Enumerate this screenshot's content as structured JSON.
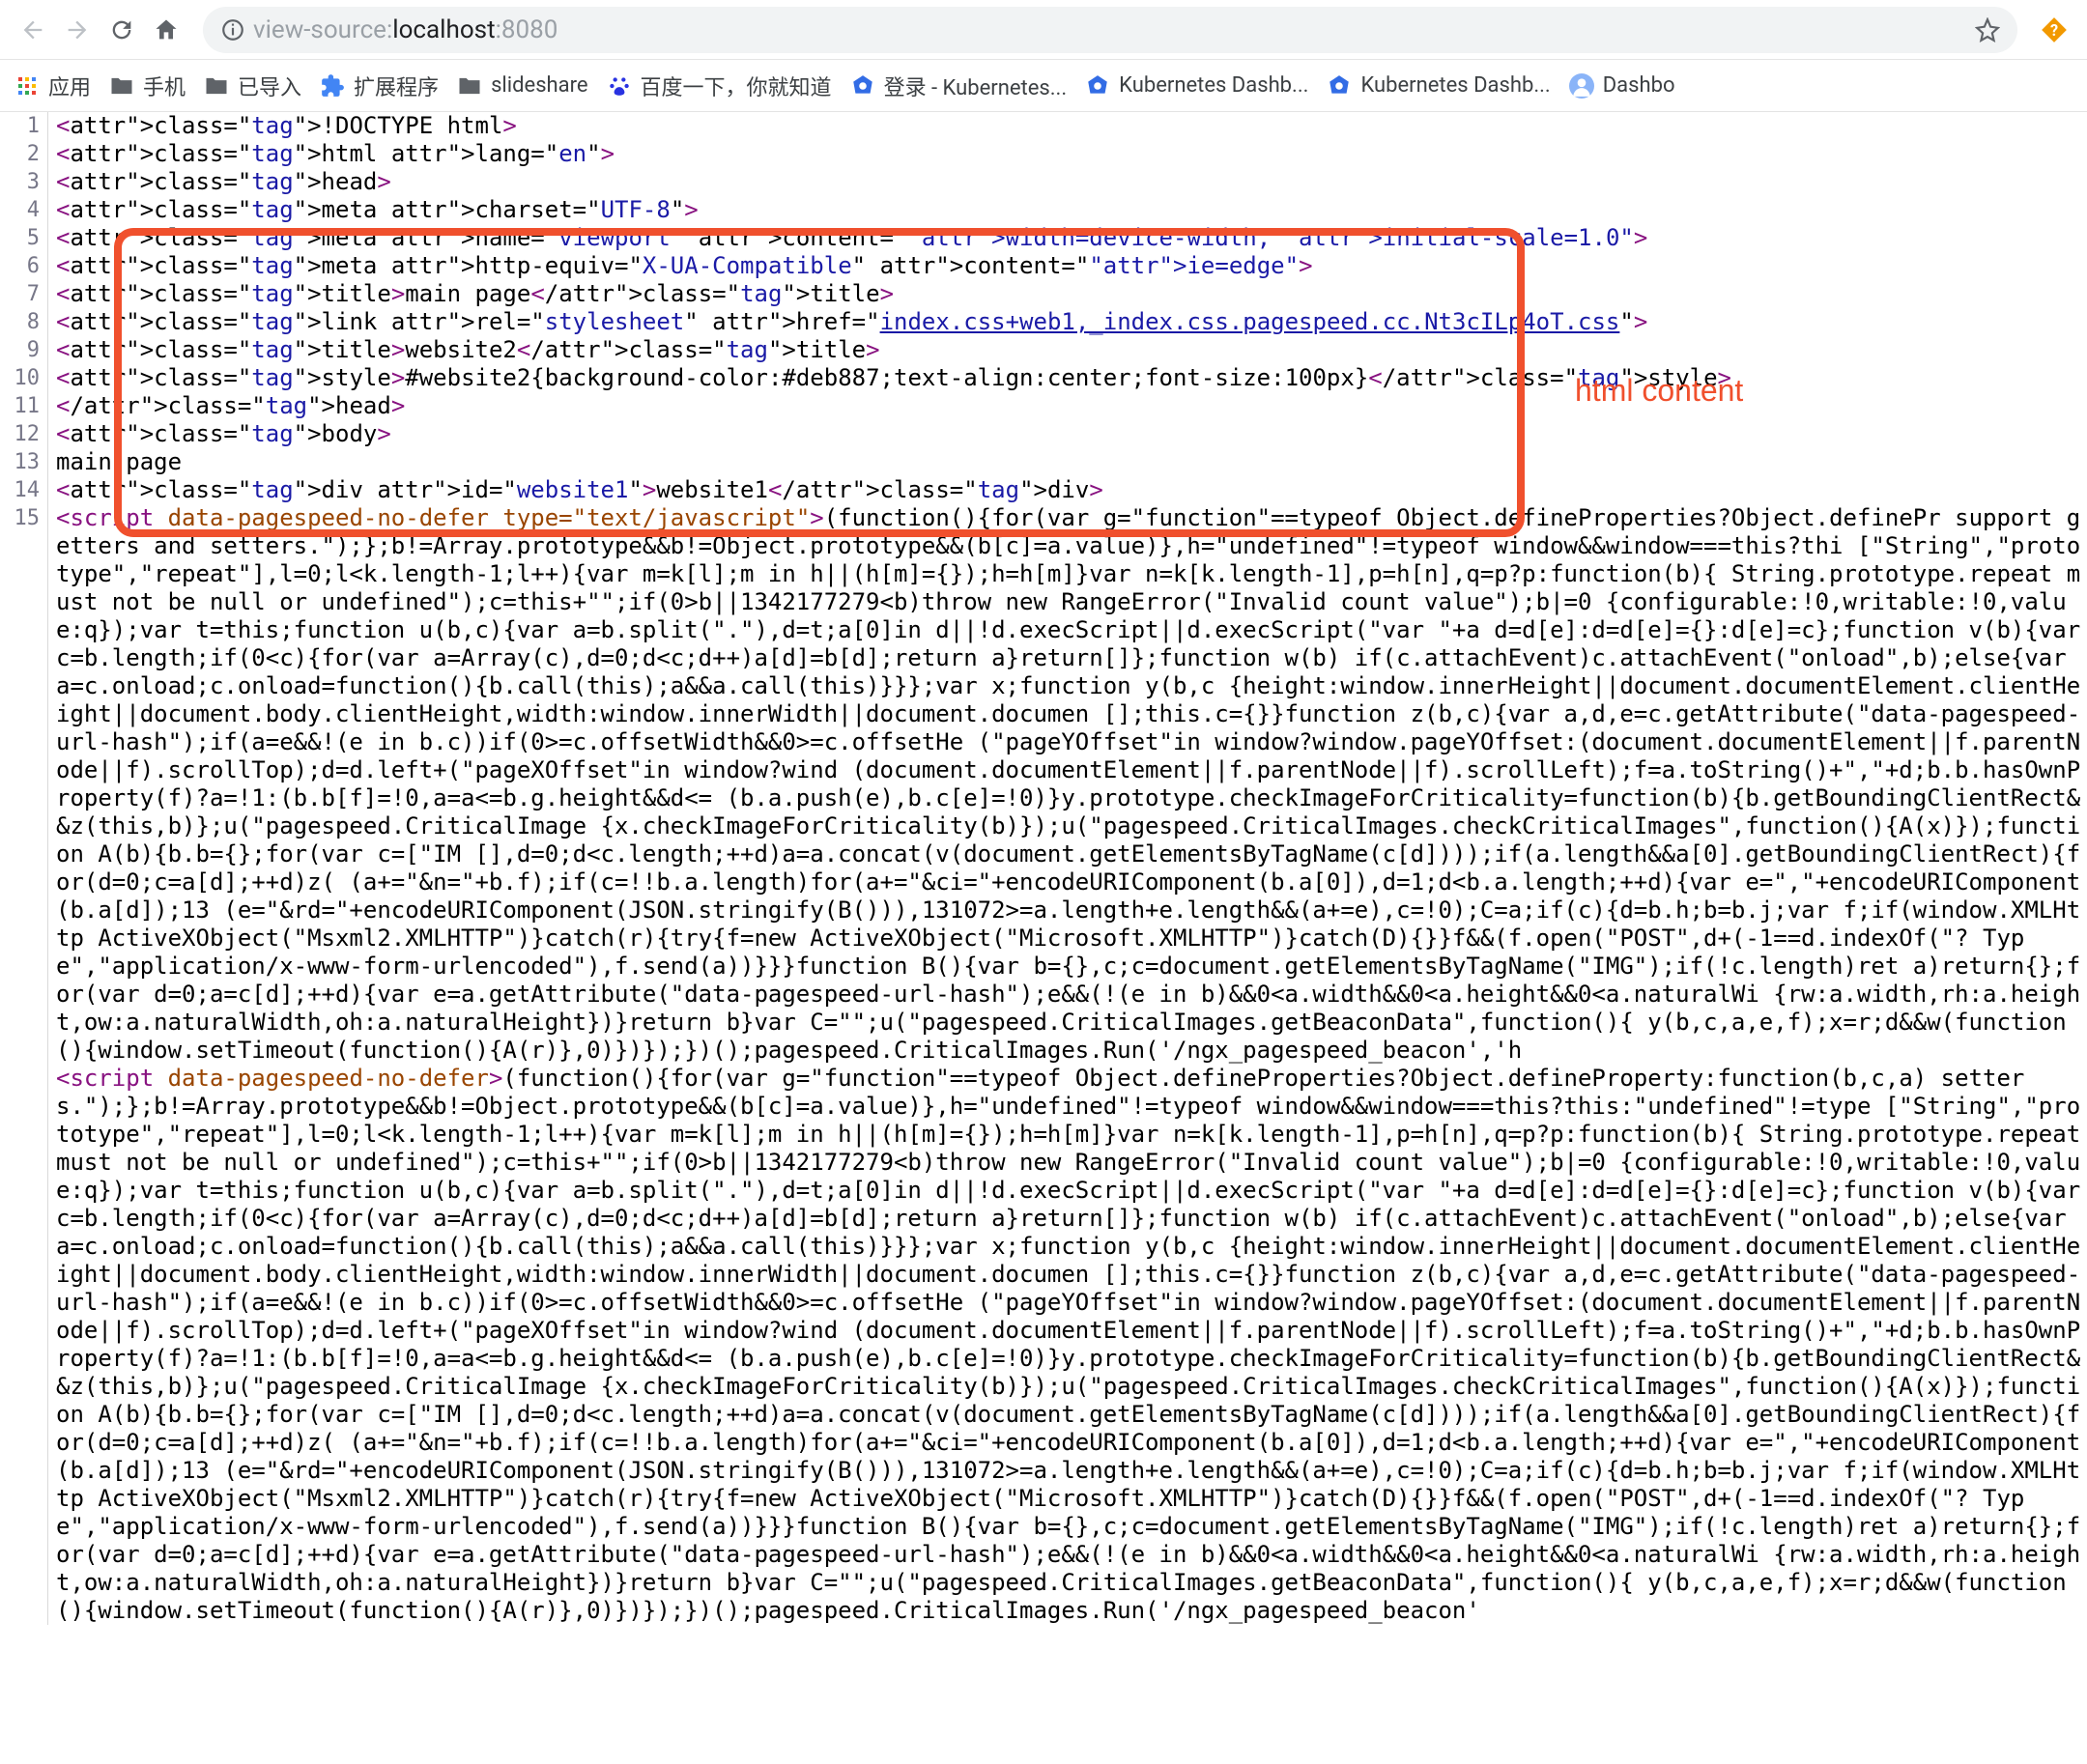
{
  "toolbar": {
    "url_prefix": "view-source:",
    "url_host": "localhost",
    "url_port": ":8080"
  },
  "bookmarks": [
    {
      "type": "apps",
      "label": "应用"
    },
    {
      "type": "folder",
      "label": "手机"
    },
    {
      "type": "folder",
      "label": "已导入"
    },
    {
      "type": "ext",
      "label": "扩展程序"
    },
    {
      "type": "folder",
      "label": "slideshare"
    },
    {
      "type": "baidu",
      "label": "百度一下，你就知道"
    },
    {
      "type": "k8s",
      "label": "登录 - Kubernetes..."
    },
    {
      "type": "k8s",
      "label": "Kubernetes Dashb..."
    },
    {
      "type": "k8s",
      "label": "Kubernetes Dashb..."
    },
    {
      "type": "avatar",
      "label": "Dashbo"
    }
  ],
  "annotation": "html content",
  "source": {
    "lines": [
      "<!DOCTYPE html>",
      "<html lang=\"en\">",
      "<head>",
      "<meta charset=\"UTF-8\">",
      "<meta name=\"viewport\" content=\"width=device-width, initial-scale=1.0\">",
      "<meta http-equiv=\"X-UA-Compatible\" content=\"ie=edge\">",
      "<title>main page</title>",
      "<link rel=\"stylesheet\" href=\"index.css+web1,_index.css.pagespeed.cc.Nt3cILp4oT.css\">",
      "<title>website2</title>",
      "<style>#website2{background-color:#deb887;text-align:center;font-size:100px}</style>",
      "</head>",
      "<body>",
      "main page",
      "<div id=\"website1\">website1</div>"
    ],
    "script1": "<script data-pagespeed-no-defer type=\"text/javascript\">(function(){for(var g=\"function\"==typeof Object.defineProperties?Object.definePr support getters and setters.\");};b!=Array.prototype&&b!=Object.prototype&&(b[c]=a.value)},h=\"undefined\"!=typeof window&&window===this?thi [\"String\",\"prototype\",\"repeat\"],l=0;l<k.length-1;l++){var m=k[l];m in h||(h[m]={});h=h[m]}var n=k[k.length-1],p=h[n],q=p?p:function(b){ String.prototype.repeat must not be null or undefined\");c=this+\"\";if(0>b||1342177279<b)throw new RangeError(\"Invalid count value\");b|=0 {configurable:!0,writable:!0,value:q});var t=this;function u(b,c){var a=b.split(\".\"),d=t;a[0]in d||!d.execScript||d.execScript(\"var \"+a d=d[e]:d=d[e]={}:d[e]=c};function v(b){var c=b.length;if(0<c){for(var a=Array(c),d=0;d<c;d++)a[d]=b[d];return a}return[]};function w(b) if(c.attachEvent)c.attachEvent(\"onload\",b);else{var a=c.onload;c.onload=function(){b.call(this);a&&a.call(this)}}};var x;function y(b,c {height:window.innerHeight||document.documentElement.clientHeight||document.body.clientHeight,width:window.innerWidth||document.documen [];this.c={}}function z(b,c){var a,d,e=c.getAttribute(\"data-pagespeed-url-hash\");if(a=e&&!(e in b.c))if(0>=c.offsetWidth&&0>=c.offsetHe (\"pageYOffset\"in window?window.pageYOffset:(document.documentElement||f.parentNode||f).scrollTop);d=d.left+(\"pageXOffset\"in window?wind (document.documentElement||f.parentNode||f).scrollLeft);f=a.toString()+\",\"+d;b.b.hasOwnProperty(f)?a=!1:(b.b[f]=!0,a=a<=b.g.height&&d<= (b.a.push(e),b.c[e]=!0)}y.prototype.checkImageForCriticality=function(b){b.getBoundingClientRect&&z(this,b)};u(\"pagespeed.CriticalImage {x.checkImageForCriticality(b)});u(\"pagespeed.CriticalImages.checkCriticalImages\",function(){A(x)});function A(b){b.b={};for(var c=[\"IM [],d=0;d<c.length;++d)a=a.concat(v(document.getElementsByTagName(c[d])));if(a.length&&a[0].getBoundingClientRect){for(d=0;c=a[d];++d)z( (a+=\"&n=\"+b.f);if(c=!!b.a.length)for(a+=\"&ci=\"+encodeURIComponent(b.a[0]),d=1;d<b.a.length;++d){var e=\",\"+encodeURIComponent(b.a[d]);13 (e=\"&rd=\"+encodeURIComponent(JSON.stringify(B())),131072>=a.length+e.length&&(a+=e),c=!0);C=a;if(c){d=b.h;b=b.j;var f;if(window.XMLHttp ActiveXObject(\"Msxml2.XMLHTTP\")}catch(r){try{f=new ActiveXObject(\"Microsoft.XMLHTTP\")}catch(D){}}f&&(f.open(\"POST\",d+(-1==d.indexOf(\"? Type\",\"application/x-www-form-urlencoded\"),f.send(a))}}}function B(){var b={},c;c=document.getElementsByTagName(\"IMG\");if(!c.length)ret a)return{};for(var d=0;a=c[d];++d){var e=a.getAttribute(\"data-pagespeed-url-hash\");e&&(!(e in b)&&0<a.width&&0<a.height&&0<a.naturalWi {rw:a.width,rh:a.height,ow:a.naturalWidth,oh:a.naturalHeight})}return b}var C=\"\";u(\"pagespeed.CriticalImages.getBeaconData\",function(){ y(b,c,a,e,f);x=r;d&&w(function(){window.setTimeout(function(){A(r)},0)})});})();pagespeed.CriticalImages.Run('/ngx_pagespeed_beacon','h",
    "script2": "<script data-pagespeed-no-defer>(function(){for(var g=\"function\"==typeof Object.defineProperties?Object.defineProperty:function(b,c,a) setters.\");};b!=Array.prototype&&b!=Object.prototype&&(b[c]=a.value)},h=\"undefined\"!=typeof window&&window===this?this:\"undefined\"!=type [\"String\",\"prototype\",\"repeat\"],l=0;l<k.length-1;l++){var m=k[l];m in h||(h[m]={});h=h[m]}var n=k[k.length-1],p=h[n],q=p?p:function(b){ String.prototype.repeat must not be null or undefined\");c=this+\"\";if(0>b||1342177279<b)throw new RangeError(\"Invalid count value\");b|=0 {configurable:!0,writable:!0,value:q});var t=this;function u(b,c){var a=b.split(\".\"),d=t;a[0]in d||!d.execScript||d.execScript(\"var \"+a d=d[e]:d=d[e]={}:d[e]=c};function v(b){var c=b.length;if(0<c){for(var a=Array(c),d=0;d<c;d++)a[d]=b[d];return a}return[]};function w(b) if(c.attachEvent)c.attachEvent(\"onload\",b);else{var a=c.onload;c.onload=function(){b.call(this);a&&a.call(this)}}};var x;function y(b,c {height:window.innerHeight||document.documentElement.clientHeight||document.body.clientHeight,width:window.innerWidth||document.documen [];this.c={}}function z(b,c){var a,d,e=c.getAttribute(\"data-pagespeed-url-hash\");if(a=e&&!(e in b.c))if(0>=c.offsetWidth&&0>=c.offsetHe (\"pageYOffset\"in window?window.pageYOffset:(document.documentElement||f.parentNode||f).scrollTop);d=d.left+(\"pageXOffset\"in window?wind (document.documentElement||f.parentNode||f).scrollLeft);f=a.toString()+\",\"+d;b.b.hasOwnProperty(f)?a=!1:(b.b[f]=!0,a=a<=b.g.height&&d<= (b.a.push(e),b.c[e]=!0)}y.prototype.checkImageForCriticality=function(b){b.getBoundingClientRect&&z(this,b)};u(\"pagespeed.CriticalImage {x.checkImageForCriticality(b)});u(\"pagespeed.CriticalImages.checkCriticalImages\",function(){A(x)});function A(b){b.b={};for(var c=[\"IM [],d=0;d<c.length;++d)a=a.concat(v(document.getElementsByTagName(c[d])));if(a.length&&a[0].getBoundingClientRect){for(d=0;c=a[d];++d)z( (a+=\"&n=\"+b.f);if(c=!!b.a.length)for(a+=\"&ci=\"+encodeURIComponent(b.a[0]),d=1;d<b.a.length;++d){var e=\",\"+encodeURIComponent(b.a[d]);13 (e=\"&rd=\"+encodeURIComponent(JSON.stringify(B())),131072>=a.length+e.length&&(a+=e),c=!0);C=a;if(c){d=b.h;b=b.j;var f;if(window.XMLHttp ActiveXObject(\"Msxml2.XMLHTTP\")}catch(r){try{f=new ActiveXObject(\"Microsoft.XMLHTTP\")}catch(D){}}f&&(f.open(\"POST\",d+(-1==d.indexOf(\"? Type\",\"application/x-www-form-urlencoded\"),f.send(a))}}}function B(){var b={},c;c=document.getElementsByTagName(\"IMG\");if(!c.length)ret a)return{};for(var d=0;a=c[d];++d){var e=a.getAttribute(\"data-pagespeed-url-hash\");e&&(!(e in b)&&0<a.width&&0<a.height&&0<a.naturalWi {rw:a.width,rh:a.height,ow:a.naturalWidth,oh:a.naturalHeight})}return b}var C=\"\";u(\"pagespeed.CriticalImages.getBeaconData\",function(){ y(b,c,a,e,f);x=r;d&&w(function(){window.setTimeout(function(){A(r)},0)})});})();pagespeed.CriticalImages.Run('/ngx_pagespeed_beacon'"
  }
}
